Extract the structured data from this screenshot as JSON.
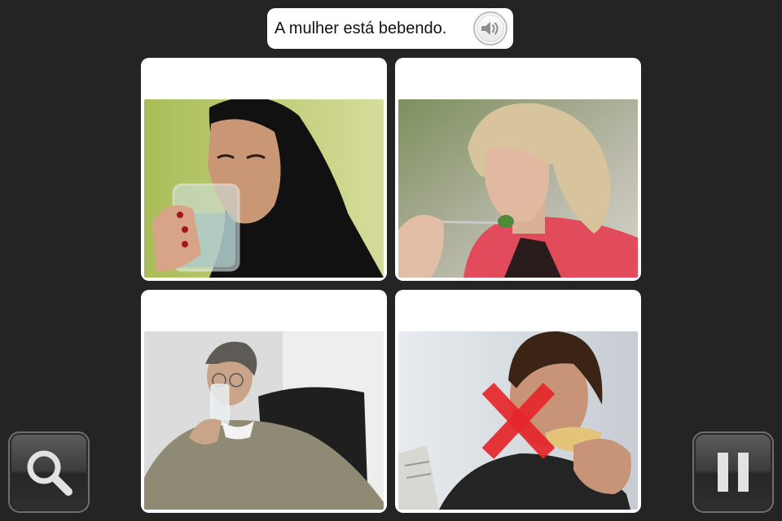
{
  "prompt": {
    "text": "A mulher está bebendo.",
    "speaker_icon": "speaker-icon"
  },
  "cards": [
    {
      "id": "card-1",
      "subject": "woman-drinking-water",
      "selected_wrong": false
    },
    {
      "id": "card-2",
      "subject": "woman-eating-salad",
      "selected_wrong": false
    },
    {
      "id": "card-3",
      "subject": "man-drinking-water",
      "selected_wrong": false
    },
    {
      "id": "card-4",
      "subject": "man-eating-sandwich",
      "selected_wrong": true,
      "mark": "red-x-icon"
    }
  ],
  "controls": {
    "zoom_icon": "magnifier-icon",
    "pause_icon": "pause-icon"
  },
  "colors": {
    "background": "#242424",
    "card": "#ffffff",
    "wrong_mark": "#e5262b"
  }
}
